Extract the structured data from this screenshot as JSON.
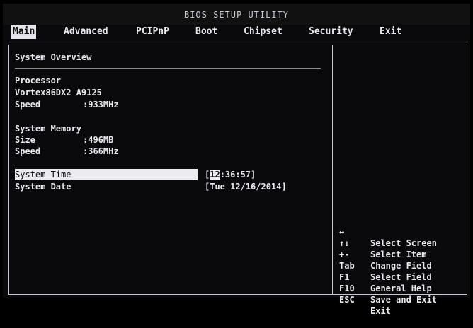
{
  "title": "BIOS SETUP UTILITY",
  "menu": [
    "Main",
    "Advanced",
    "PCIPnP",
    "Boot",
    "Chipset",
    "Security",
    "Exit"
  ],
  "section_title": "System Overview",
  "processor": {
    "heading": "Processor",
    "model": "Vortex86DX2 A9125",
    "speed_label": "Speed",
    "speed_value": ":933MHz"
  },
  "memory": {
    "heading": "System Memory",
    "size_label": "Size",
    "size_value": ":496MB",
    "speed_label": "Speed",
    "speed_value": ":366MHz"
  },
  "time": {
    "label": "System Time",
    "open": "[",
    "hour": "12",
    "rest": ":36:57]"
  },
  "date": {
    "label": "System Date",
    "value": "[Tue 12/16/2014]"
  },
  "help": [
    {
      "key": "↔",
      "desc": "Select Screen"
    },
    {
      "key": "↑↓",
      "desc": "Select Item"
    },
    {
      "key": "+-",
      "desc": "Change Field"
    },
    {
      "key": "Tab",
      "desc": "Select Field"
    },
    {
      "key": "F1",
      "desc": "General Help"
    },
    {
      "key": "F10",
      "desc": "Save and Exit"
    },
    {
      "key": "ESC",
      "desc": "Exit"
    }
  ]
}
